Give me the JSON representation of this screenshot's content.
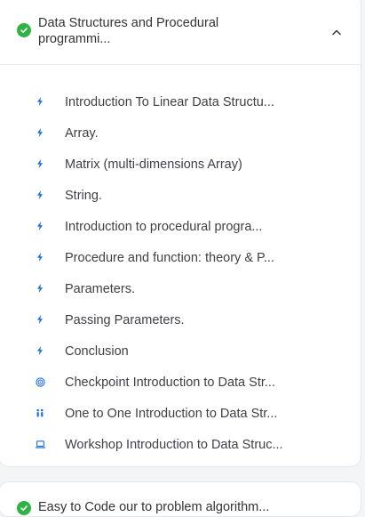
{
  "section1": {
    "title": "Data Structures and Procedural\nprogrammi...",
    "status_icon": "check-circle-icon",
    "expand_icon": "chevron-up-icon",
    "colors": {
      "complete": "#2fb344",
      "accent": "#1a6fe0"
    },
    "lessons": [
      {
        "label": "Introduction To Linear Data Structu...",
        "icon": "lightning-icon"
      },
      {
        "label": "Array.",
        "icon": "lightning-icon"
      },
      {
        "label": "Matrix (multi-dimensions Array)",
        "icon": "lightning-icon"
      },
      {
        "label": "String.",
        "icon": "lightning-icon"
      },
      {
        "label": "Introduction to procedural progra...",
        "icon": "lightning-icon"
      },
      {
        "label": "Procedure and function: theory & P...",
        "icon": "lightning-icon"
      },
      {
        "label": "Parameters.",
        "icon": "lightning-icon"
      },
      {
        "label": "Passing Parameters.",
        "icon": "lightning-icon"
      },
      {
        "label": "Conclusion",
        "icon": "lightning-icon"
      },
      {
        "label": "Checkpoint Introduction to Data Str...",
        "icon": "target-icon"
      },
      {
        "label": "One to One Introduction to Data Str...",
        "icon": "people-icon"
      },
      {
        "label": "Workshop Introduction to Data Struc...",
        "icon": "laptop-icon"
      }
    ]
  },
  "section2": {
    "title": "Easy to Code our to problem algorithm...",
    "status_icon": "check-circle-icon"
  }
}
